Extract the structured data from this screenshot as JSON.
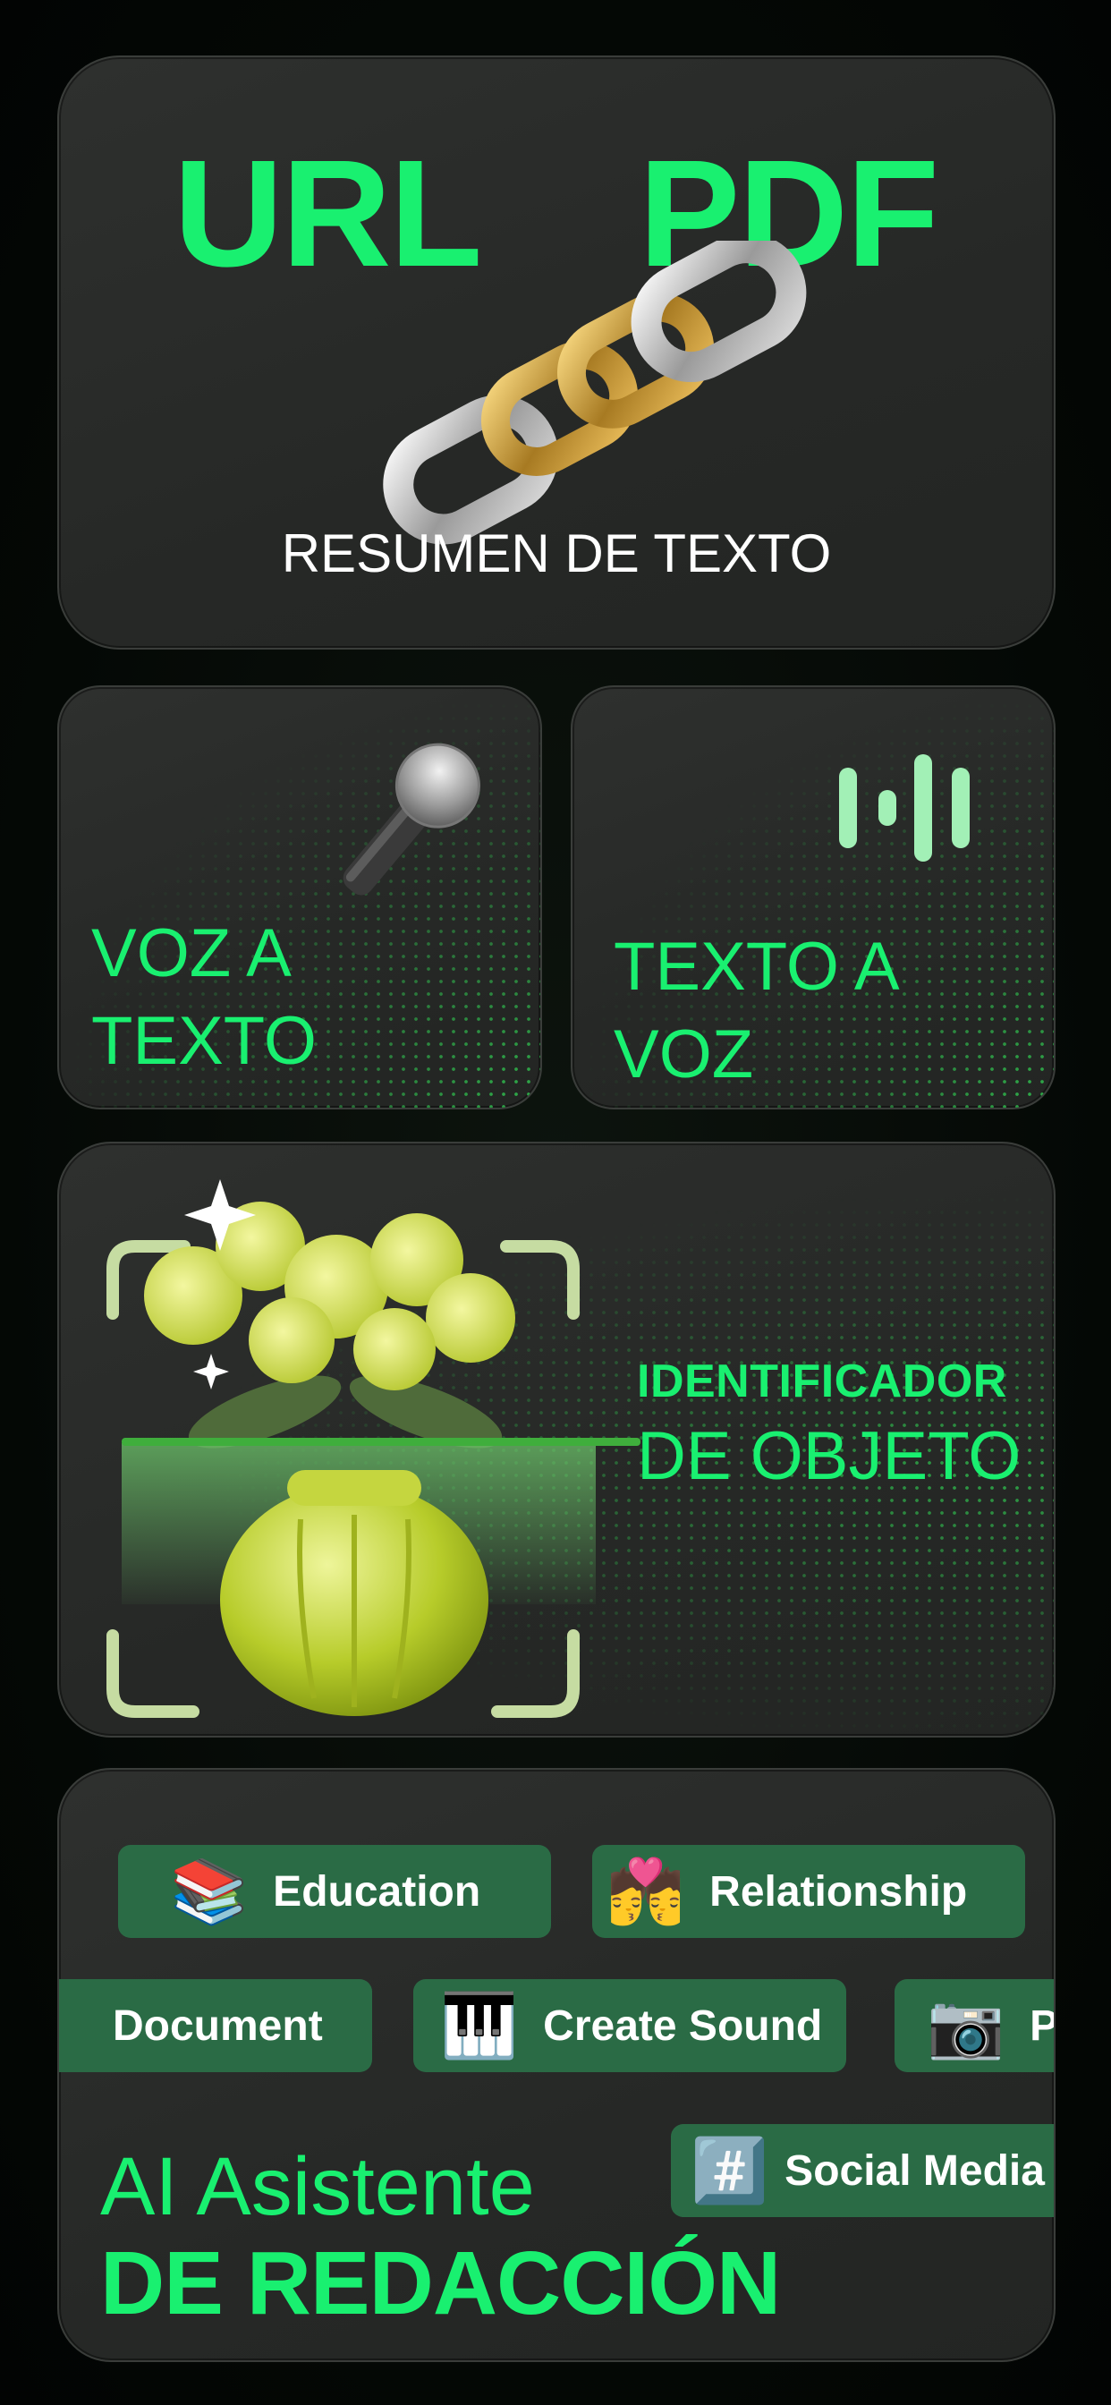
{
  "summary_card": {
    "word_left": "URL",
    "word_right": "PDF",
    "caption": "RESUMEN DE TEXTO",
    "icon": "chain-link-icon"
  },
  "voice_to_text": {
    "line1": "VOZ A",
    "line2": "TEXTO",
    "icon": "microphone-icon"
  },
  "text_to_voice": {
    "line1": "TEXTO A",
    "line2": "VOZ",
    "icon": "soundwave-icon"
  },
  "object_id": {
    "line1": "IDENTIFICADOR",
    "line2": "DE OBJETO",
    "image": "flower-vase-scan"
  },
  "writing_assistant": {
    "line1": "AI Asistente",
    "line2": "DE REDACCIÓN",
    "tags": [
      {
        "label": "Education",
        "emoji": "📚",
        "icon": "books-icon"
      },
      {
        "label": "Relationship",
        "emoji": "💏",
        "icon": "couple-kiss-icon"
      },
      {
        "label": "Document",
        "emoji": "",
        "icon": ""
      },
      {
        "label": "Create Sound",
        "emoji": "🎹",
        "icon": "piano-icon"
      },
      {
        "label": "P",
        "emoji": "📷",
        "icon": "camera-icon"
      },
      {
        "label": "Social Media",
        "emoji": "#️⃣",
        "icon": "hashtag-icon"
      }
    ]
  },
  "colors": {
    "accent": "#19f070",
    "card_bg": "#2a2c2a",
    "pill_bg": "#2a6b45",
    "page_bg": "#040805"
  }
}
